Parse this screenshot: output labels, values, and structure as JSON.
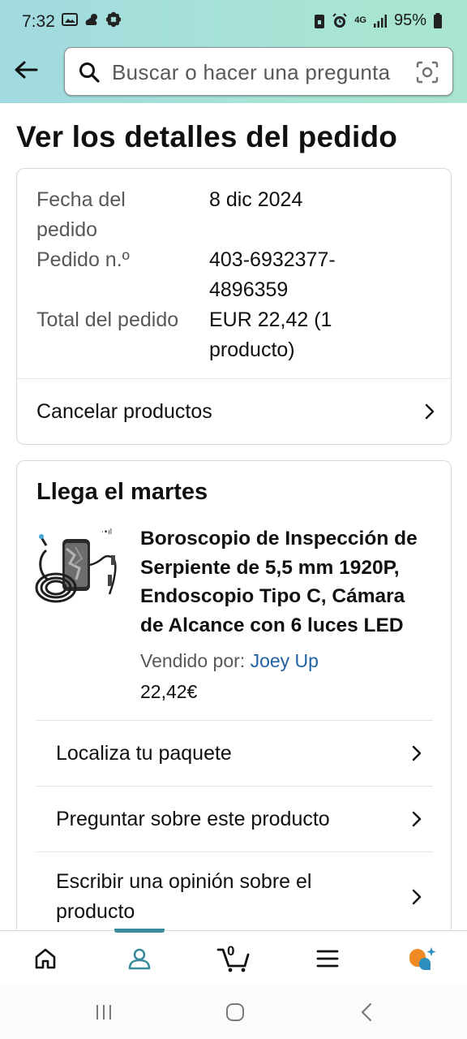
{
  "status_bar": {
    "time": "7:32",
    "battery_percent": "95%",
    "network_label": "4G"
  },
  "search": {
    "placeholder": "Buscar o hacer una pregunta"
  },
  "page": {
    "title": "Ver los detalles del pedido"
  },
  "order": {
    "date_label": "Fecha del pedido",
    "date_value": "8 dic 2024",
    "number_label": "Pedido n.º",
    "number_value": "403-6932377-4896359",
    "total_label": "Total del pedido",
    "total_value": "EUR 22,42 (1 producto)",
    "cancel_label": "Cancelar productos"
  },
  "shipment": {
    "heading": "Llega el martes",
    "product_title": "Boroscopio de Inspección de Serpiente de 5,5 mm 1920P, Endoscopio Tipo C, Cámara de Alcance con 6 luces LED",
    "sold_by_label": "Vendido por: ",
    "seller_name": "Joey Up",
    "price": "22,42€",
    "actions": {
      "track": "Localiza tu paquete",
      "ask": "Preguntar sobre este producto",
      "review": "Escribir una opinión sobre el producto"
    }
  },
  "bottom_nav": {
    "cart_count": "0",
    "items": [
      "home-icon",
      "account-icon",
      "cart-icon",
      "menu-icon",
      "rufus-icon"
    ],
    "active": "account-icon"
  },
  "colors": {
    "header_gradient_start": "#a1d9e0",
    "header_gradient_end": "#a9e5cf",
    "link": "#2162a1",
    "active_tab": "#3a8a9b"
  }
}
